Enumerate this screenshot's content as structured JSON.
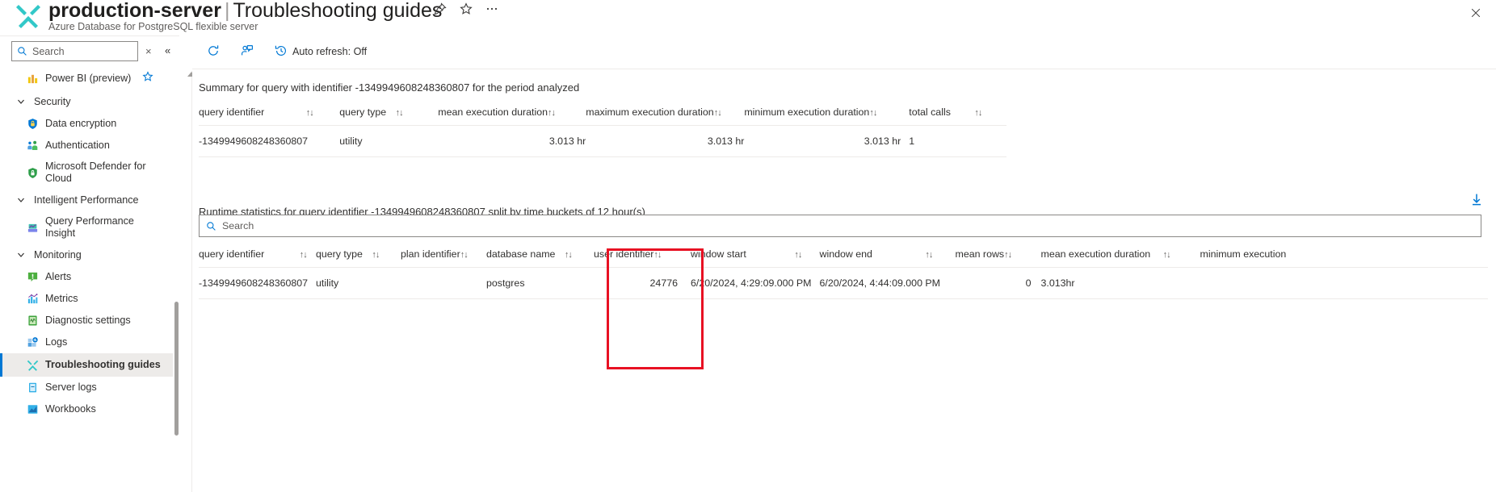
{
  "titlebar": {
    "resource_name": "production-server",
    "separator": "|",
    "page_name": "Troubleshooting guides",
    "subtitle": "Azure Database for PostgreSQL flexible server",
    "pin_icon": "pin-icon",
    "favorite_icon": "star-icon",
    "more_icon": "ellipsis-icon",
    "close_icon": "close-icon"
  },
  "sidebar": {
    "search": {
      "placeholder": "Search",
      "value": "",
      "icon": "search-icon"
    },
    "clear_label": "×",
    "collapse_label": "«",
    "items": [
      {
        "label": "Power BI (preview)",
        "icon": "power-bi-icon",
        "type": "item",
        "favorited": true
      },
      {
        "label": "Security",
        "icon": "chevron-down-icon",
        "type": "group"
      },
      {
        "label": "Data encryption",
        "icon": "lock-shield-icon",
        "type": "item"
      },
      {
        "label": "Authentication",
        "icon": "authentication-icon",
        "type": "item"
      },
      {
        "label": "Microsoft Defender for Cloud",
        "icon": "defender-shield-icon",
        "type": "item"
      },
      {
        "label": "Intelligent Performance",
        "icon": "chevron-down-icon",
        "type": "group"
      },
      {
        "label": "Query Performance Insight",
        "icon": "query-performance-icon",
        "type": "item"
      },
      {
        "label": "Monitoring",
        "icon": "chevron-down-icon",
        "type": "group"
      },
      {
        "label": "Alerts",
        "icon": "alerts-icon",
        "type": "item"
      },
      {
        "label": "Metrics",
        "icon": "metrics-icon",
        "type": "item"
      },
      {
        "label": "Diagnostic settings",
        "icon": "diagnostic-settings-icon",
        "type": "item"
      },
      {
        "label": "Logs",
        "icon": "logs-icon",
        "type": "item"
      },
      {
        "label": "Troubleshooting guides",
        "icon": "troubleshooting-icon",
        "type": "item",
        "selected": true
      },
      {
        "label": "Server logs",
        "icon": "server-logs-icon",
        "type": "item"
      },
      {
        "label": "Workbooks",
        "icon": "workbooks-icon",
        "type": "item"
      }
    ]
  },
  "commandbar": {
    "refresh": {
      "label": "",
      "icon": "refresh-icon"
    },
    "feedback": {
      "label": "",
      "icon": "feedback-person-icon"
    },
    "auto_refresh": {
      "label": "Auto refresh: Off",
      "icon": "clock-history-icon"
    }
  },
  "summary_section": {
    "title": "Summary for query with identifier -1349949608248360807 for the period analyzed",
    "columns": [
      "query identifier",
      "query type",
      "mean execution duration",
      "maximum execution duration",
      "minimum execution duration",
      "total calls"
    ],
    "sort_glyph": "↑↓",
    "rows": [
      {
        "query_identifier": "-1349949608248360807",
        "query_type": "utility",
        "mean_execution_duration": "3.013 hr",
        "maximum_execution_duration": "3.013 hr",
        "minimum_execution_duration": "3.013 hr",
        "total_calls": "1"
      }
    ]
  },
  "runtime_section": {
    "title": "Runtime statistics for query identifier -1349949608248360807 split by time buckets of 12 hour(s)",
    "download_icon": "download-icon",
    "search": {
      "placeholder": "Search",
      "value": "",
      "icon": "search-icon"
    },
    "columns": [
      "query identifier",
      "query type",
      "plan identifier",
      "database name",
      "user identifier",
      "window start",
      "window end",
      "mean rows",
      "mean execution duration",
      "minimum execution"
    ],
    "sort_glyph": "↑↓",
    "rows": [
      {
        "query_identifier": "-1349949608248360807",
        "query_type": "utility",
        "plan_identifier": "",
        "database_name": "postgres",
        "user_identifier": "24776",
        "window_start": "6/20/2024, 4:29:09.000 PM",
        "window_end": "6/20/2024, 4:44:09.000 PM",
        "mean_rows": "0",
        "mean_execution_duration": "3.013hr",
        "minimum_execution": ""
      }
    ],
    "highlight": {
      "name": "user-identifier-column-highlight",
      "color": "#e81123"
    }
  },
  "colors": {
    "accent": "#0078d4",
    "highlight": "#e81123",
    "selected_bg": "#edebe9",
    "text": "#323130",
    "muted": "#605e5c"
  }
}
